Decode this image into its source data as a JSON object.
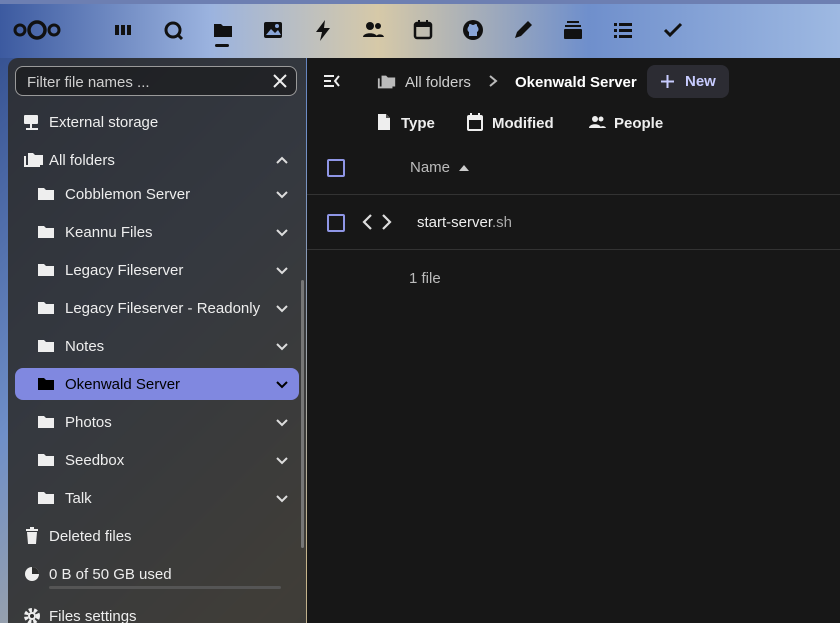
{
  "topbar": {
    "apps": [
      "logo-icon",
      "dashboard-icon",
      "talk-icon",
      "files-icon",
      "photos-icon",
      "activity-icon",
      "contacts-icon",
      "calendar-icon",
      "github-icon",
      "notes-icon",
      "deck-icon",
      "tasks-icon",
      "check-icon"
    ],
    "active_app": "files-icon"
  },
  "sidebar": {
    "filter_placeholder": "Filter file names ...",
    "external_storage": "External storage",
    "all_folders": "All folders",
    "folders": [
      {
        "label": "Cobblemon Server"
      },
      {
        "label": "Keannu Files"
      },
      {
        "label": "Legacy Fileserver"
      },
      {
        "label": "Legacy Fileserver - Readonly"
      },
      {
        "label": "Notes"
      },
      {
        "label": "Okenwald Server",
        "active": true
      },
      {
        "label": "Photos"
      },
      {
        "label": "Seedbox"
      },
      {
        "label": "Talk"
      }
    ],
    "deleted_files": "Deleted files",
    "quota": "0 B of 50 GB used",
    "quota_fraction": 0,
    "settings": "Files settings"
  },
  "main": {
    "breadcrumb_root": "All folders",
    "breadcrumb_current": "Okenwald Server",
    "new_button": "New",
    "filters": {
      "type": "Type",
      "modified": "Modified",
      "people": "People"
    },
    "column_name": "Name",
    "files": [
      {
        "base": "start-server",
        "ext": ".sh"
      }
    ],
    "summary": "1 file"
  },
  "colors": {
    "accent": "#8088e0",
    "checkbox": "#8f96e6",
    "background": "#171717"
  }
}
